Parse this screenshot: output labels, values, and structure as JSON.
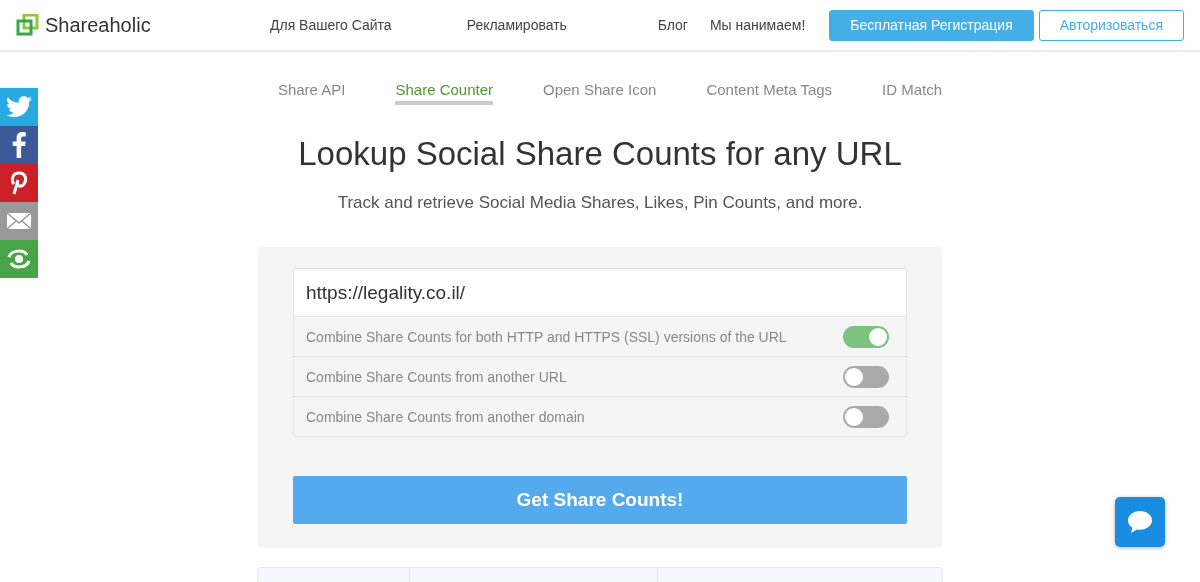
{
  "header": {
    "logo": "Shareaholic",
    "nav_left": [
      "Для Вашего Сайта",
      "Рекламировать"
    ],
    "nav_right": [
      "Блог",
      "Мы нанимаем!"
    ],
    "signup_button": "Бесплатная Регистрация",
    "login_button": "Авторизоваться"
  },
  "share_bar": [
    {
      "kind": "twitter",
      "color": "#29a9e1"
    },
    {
      "kind": "facebook",
      "color": "#3b5998"
    },
    {
      "kind": "pinterest",
      "color": "#cb2027"
    },
    {
      "kind": "email",
      "color": "#999999"
    },
    {
      "kind": "more",
      "color": "#47a447"
    }
  ],
  "tabs": [
    {
      "label": "Share API",
      "selected": false
    },
    {
      "label": "Share Counter",
      "selected": true
    },
    {
      "label": "Open Share Icon",
      "selected": false
    },
    {
      "label": "Content Meta Tags",
      "selected": false
    },
    {
      "label": "ID Match",
      "selected": false
    }
  ],
  "title": "Lookup Social Share Counts for any URL",
  "subtitle": "Track and retrieve Social Media Shares, Likes, Pin Counts, and more.",
  "url_field": {
    "value": "https://legality.co.il/"
  },
  "options": [
    {
      "label": "Combine Share Counts for both HTTP and HTTPS (SSL) versions of the URL",
      "on": true
    },
    {
      "label": "Combine Share Counts from another URL",
      "on": false
    },
    {
      "label": "Combine Share Counts from another domain",
      "on": false
    }
  ],
  "submit_button": "Get Share Counts!"
}
